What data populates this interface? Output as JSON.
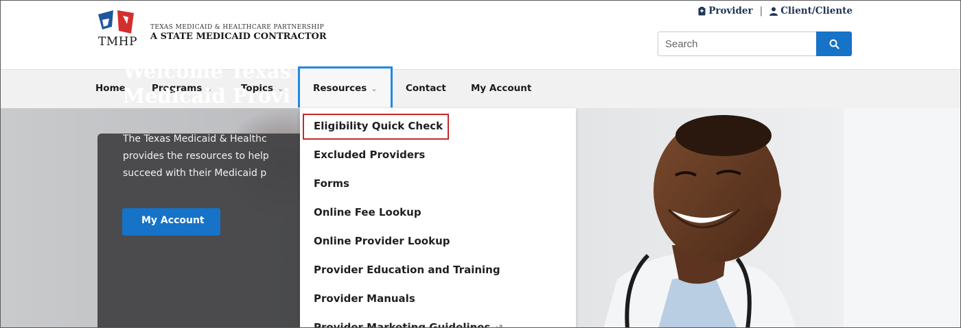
{
  "brand": {
    "logo_text": "TMHP",
    "partnership": "TEXAS MEDICAID & HEALTHCARE PARTNERSHIP",
    "contractor": "A STATE MEDICAID CONTRACTOR"
  },
  "top_links": {
    "provider": "Provider",
    "separator": "|",
    "client": "Client/Cliente"
  },
  "search": {
    "placeholder": "Search"
  },
  "nav": {
    "items": [
      {
        "label": "Home"
      },
      {
        "label": "Programs",
        "chevron": "⌄"
      },
      {
        "label": "Topics",
        "chevron": "⌄"
      },
      {
        "label": "Resources",
        "chevron": "⌄"
      },
      {
        "label": "Contact"
      },
      {
        "label": "My Account"
      }
    ],
    "active": "Resources"
  },
  "dropdown": {
    "items": [
      "Eligibility Quick Check",
      "Excluded Providers",
      "Forms",
      "Online Fee Lookup",
      "Online Provider Lookup",
      "Provider Education and Training",
      "Provider Manuals",
      "Provider Marketing Guidelines"
    ],
    "highlighted": "Eligibility Quick Check"
  },
  "hero": {
    "title_line1": "Welcome Texas",
    "title_line2": "Medicaid Provi",
    "desc_line1": "The Texas Medicaid & Healthc",
    "desc_line2": "provides the resources to help",
    "desc_line3": "succeed with their Medicaid p",
    "button_label": "My Account"
  },
  "colors": {
    "accent_blue": "#1673c7",
    "highlight_red": "#c62828",
    "active_border": "#1e88e5",
    "nav_bg": "#f1f1f1"
  },
  "icons": {
    "search": "search-icon",
    "provider": "provider-icon",
    "client": "person-icon",
    "external": "external-link-icon"
  }
}
